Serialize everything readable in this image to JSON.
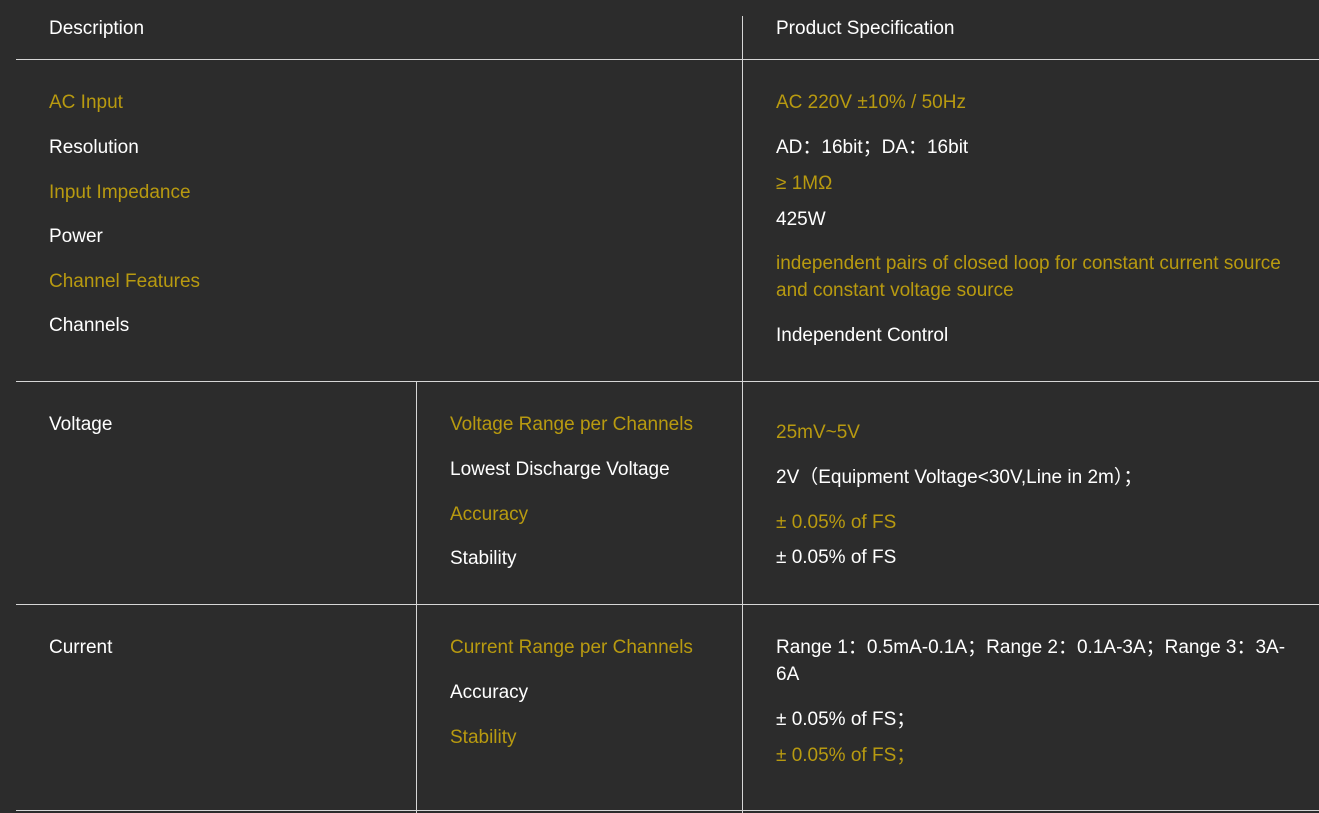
{
  "colors": {
    "background": "#2c2c2c",
    "accent_gold": "#b89a10",
    "text_white": "#ffffff",
    "border": "#d6d6d6"
  },
  "header": {
    "description": "Description",
    "product_specification": "Product Specification"
  },
  "general": {
    "labels": [
      {
        "text": "AC Input",
        "color": "gold"
      },
      {
        "text": "Resolution",
        "color": "white"
      },
      {
        "text": "Input Impedance",
        "color": "gold"
      },
      {
        "text": "Power",
        "color": "white"
      },
      {
        "text": "Channel Features",
        "color": "gold"
      },
      {
        "text": "Channels",
        "color": "white"
      }
    ],
    "values": [
      {
        "text": "AC 220V ±10% / 50Hz",
        "color": "gold"
      },
      {
        "text": "AD：16bit；DA：16bit",
        "color": "white"
      },
      {
        "text": "≥ 1MΩ",
        "color": "gold"
      },
      {
        "text": "425W",
        "color": "white"
      },
      {
        "text": "independent pairs of closed loop for constant current source and constant voltage source",
        "color": "gold"
      },
      {
        "text": "Independent Control",
        "color": "white"
      }
    ]
  },
  "voltage": {
    "category": "Voltage",
    "labels": [
      {
        "text": "Voltage Range per Channels",
        "color": "gold"
      },
      {
        "text": "Lowest Discharge Voltage",
        "color": "white"
      },
      {
        "text": "Accuracy",
        "color": "gold"
      },
      {
        "text": "Stability",
        "color": "white"
      }
    ],
    "values": [
      {
        "text": "25mV~5V",
        "color": "gold"
      },
      {
        "text": "2V（Equipment Voltage<30V,Line in 2m）；",
        "color": "white"
      },
      {
        "text": "± 0.05% of FS",
        "color": "gold"
      },
      {
        "text": "± 0.05% of FS",
        "color": "white"
      }
    ]
  },
  "current": {
    "category": "Current",
    "labels": [
      {
        "text": "Current Range per Channels",
        "color": "gold"
      },
      {
        "text": "Accuracy",
        "color": "white"
      },
      {
        "text": "Stability",
        "color": "gold"
      }
    ],
    "values": [
      {
        "text": "Range 1：0.5mA-0.1A；Range 2：0.1A-3A；Range 3：3A-6A",
        "color": "white"
      },
      {
        "text": "± 0.05% of FS；",
        "color": "white"
      },
      {
        "text": "± 0.05% of FS；",
        "color": "gold"
      }
    ]
  }
}
